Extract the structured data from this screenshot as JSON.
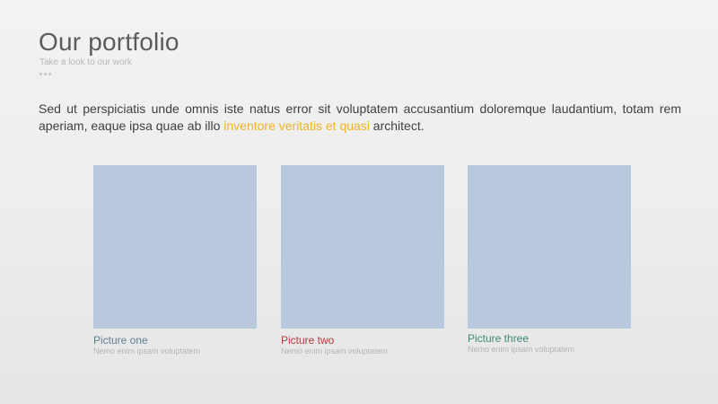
{
  "header": {
    "title": "Our portfolio",
    "subtitle": "Take a look to our work"
  },
  "intro": {
    "text_before": "Sed ut perspiciatis unde omnis iste natus error sit voluptatem accusantium doloremque laudantium, totam rem aperiam, eaque ipsa quae ab illo ",
    "highlight": "inventore veritatis et quasi",
    "text_after": " architect."
  },
  "colors": {
    "accent_yellow": "#f0b323",
    "picture_placeholder": "#b8c8dd",
    "card_one_title": "#5f7f8f",
    "card_two_title": "#b23a3a",
    "card_three_title": "#3f8a7a"
  },
  "cards": [
    {
      "title": "Picture one",
      "subtitle": "Nemo enim ipsam voluptatem"
    },
    {
      "title": "Picture two",
      "subtitle": "Nemo enim ipsam voluptatem"
    },
    {
      "title": "Picture three",
      "subtitle": "Nemo enim ipsam voluptatem"
    }
  ]
}
